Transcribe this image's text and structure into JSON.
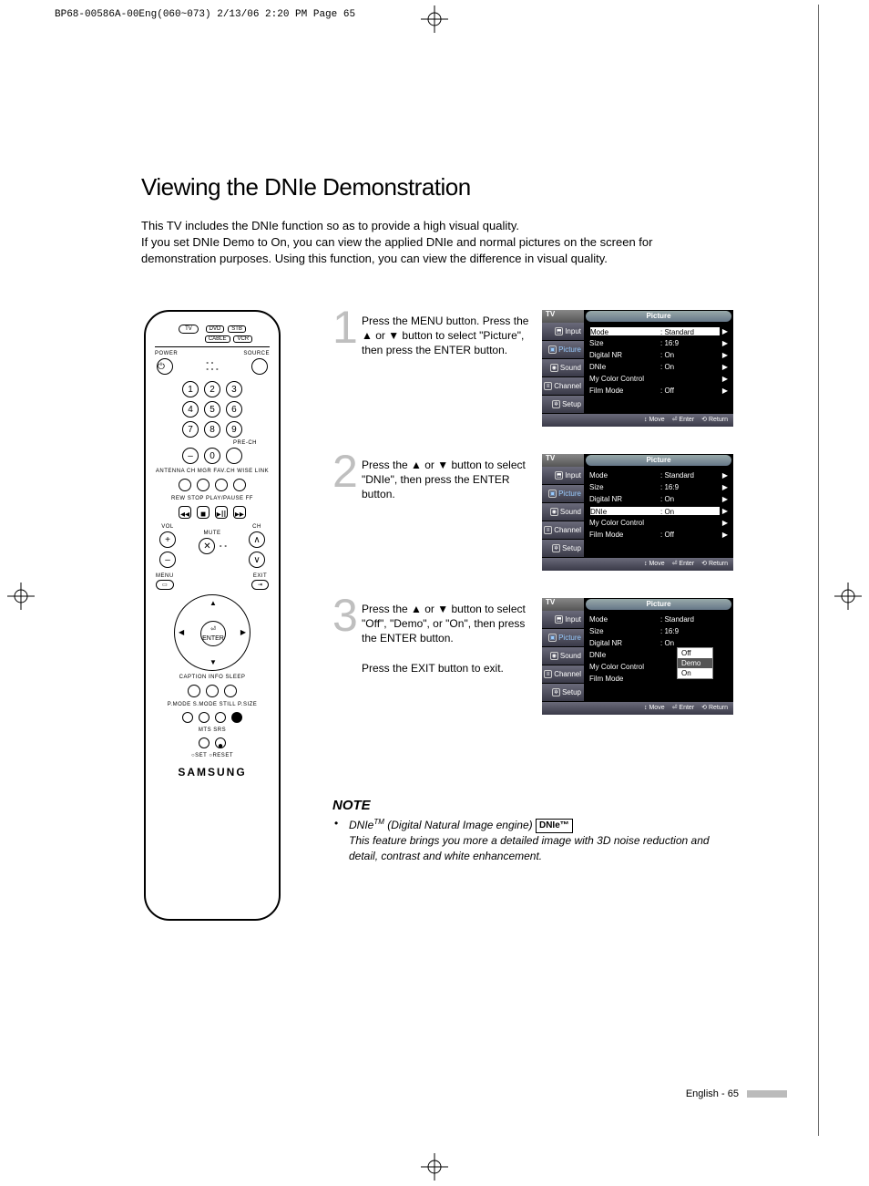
{
  "print_header": "BP68-00586A-00Eng(060~073)  2/13/06  2:20 PM  Page 65",
  "title": "Viewing the DNIe Demonstration",
  "intro_l1": "This TV includes the DNIe function so as to provide a high visual quality.",
  "intro_l2": "If you set DNIe Demo to On, you can view the applied DNIe and normal pictures on the screen for demonstration purposes. Using this function, you can view the difference in visual quality.",
  "steps": [
    {
      "num": "1",
      "text": "Press the MENU button. Press the ▲ or ▼ button to select \"Picture\", then press the ENTER button."
    },
    {
      "num": "2",
      "text": "Press the ▲ or ▼ button to select \"DNIe\", then press the ENTER button."
    },
    {
      "num": "3",
      "text": "Press the ▲ or ▼ button to select \"Off\", \"Demo\", or \"On\", then press the ENTER button.",
      "text2": "Press the EXIT button to exit."
    }
  ],
  "osd": {
    "tv": "TV",
    "title": "Picture",
    "tabs": [
      "Input",
      "Picture",
      "Sound",
      "Channel",
      "Setup"
    ],
    "rows": [
      {
        "k": "Mode",
        "v": ": Standard"
      },
      {
        "k": "Size",
        "v": ": 16:9"
      },
      {
        "k": "Digital NR",
        "v": ": On"
      },
      {
        "k": "DNIe",
        "v": ": On"
      },
      {
        "k": "My Color Control",
        "v": ""
      },
      {
        "k": "Film Mode",
        "v": ": Off"
      }
    ],
    "footer": {
      "move": "Move",
      "enter": "Enter",
      "ret": "Return"
    },
    "popup_opts": [
      "Off",
      "Demo",
      "On"
    ]
  },
  "remote": {
    "src_row": [
      "DVD",
      "STB"
    ],
    "src_row2": [
      "CABLE",
      "VCR"
    ],
    "tv": "TV",
    "power": "POWER",
    "source": "SOURCE",
    "numbers": [
      "1",
      "2",
      "3",
      "4",
      "5",
      "6",
      "7",
      "8",
      "9",
      "0"
    ],
    "dash": "–",
    "prech": "PRE-CH",
    "row_labels": "ANTENNA  CH MGR  FAV.CH  WISE LINK",
    "transport": "REW   STOP   PLAY/PAUSE   FF",
    "volch": {
      "vol": "VOL",
      "ch": "CH",
      "mute": "MUTE"
    },
    "menu": "MENU",
    "exit": "EXIT",
    "enter": "ENTER",
    "row_cis": "CAPTION   INFO   SLEEP",
    "row_pm": "P.MODE  S.MODE  STILL  P.SIZE",
    "row_mts": "MTS   SRS",
    "row_set": "○SET   ○RESET",
    "brand": "SAMSUNG"
  },
  "note": {
    "heading": "NOTE",
    "line1a": "DNIe",
    "line1b": " (Digital Natural Image engine) ",
    "badge": "DNIe™",
    "line2": "This feature brings you more a detailed image with 3D noise reduction and detail, contrast and white enhancement."
  },
  "page_label": "English - 65",
  "glyphs": {
    "up": "▲",
    "down": "▼",
    "right": "▶",
    "updown": "↕",
    "enter": "⏎",
    "ret": "⟲"
  }
}
